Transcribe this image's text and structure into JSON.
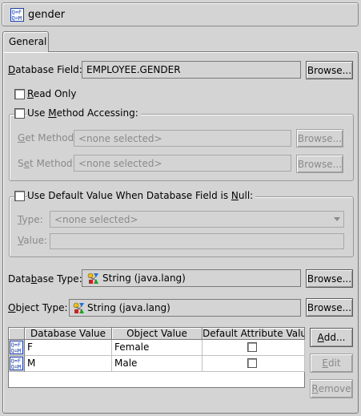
{
  "header": {
    "title": "gender",
    "icon": "direct-to-field-mapping-icon"
  },
  "tabs": [
    {
      "label": "General",
      "selected": true
    }
  ],
  "database_field": {
    "label": "Database Field:",
    "value": "EMPLOYEE.GENDER",
    "browse_label": "Browse..."
  },
  "read_only": {
    "label": "Read Only",
    "checked": false
  },
  "method_accessing": {
    "label": "Use Method Accessing:",
    "checked": false,
    "get_method": {
      "label": "Get Method:",
      "value": "<none selected>",
      "browse_label": "Browse..."
    },
    "set_method": {
      "label": "Set Method:",
      "value": "<none selected>",
      "browse_label": "Browse..."
    }
  },
  "default_value": {
    "label": "Use Default Value When Database Field is Null:",
    "checked": false,
    "type": {
      "label": "Type:",
      "value": "<none selected>"
    },
    "value": {
      "label": "Value:",
      "value": ""
    }
  },
  "database_type": {
    "label": "Database Type:",
    "value": "String (java.lang)",
    "browse_label": "Browse..."
  },
  "object_type": {
    "label": "Object Type:",
    "value": "String (java.lang)",
    "browse_label": "Browse..."
  },
  "conversion_table": {
    "columns": [
      "Database Value",
      "Object Value",
      "Default Attribute Value"
    ],
    "rows": [
      {
        "database_value": "F",
        "object_value": "Female",
        "default": false
      },
      {
        "database_value": "M",
        "object_value": "Male",
        "default": false
      }
    ],
    "add_label": "Add...",
    "edit_label": "Edit",
    "remove_label": "Remove"
  },
  "colors": {
    "background": "#d4d4d4",
    "disabled_text": "#8a8a8a",
    "icon_blue": "#1a3fa8"
  }
}
